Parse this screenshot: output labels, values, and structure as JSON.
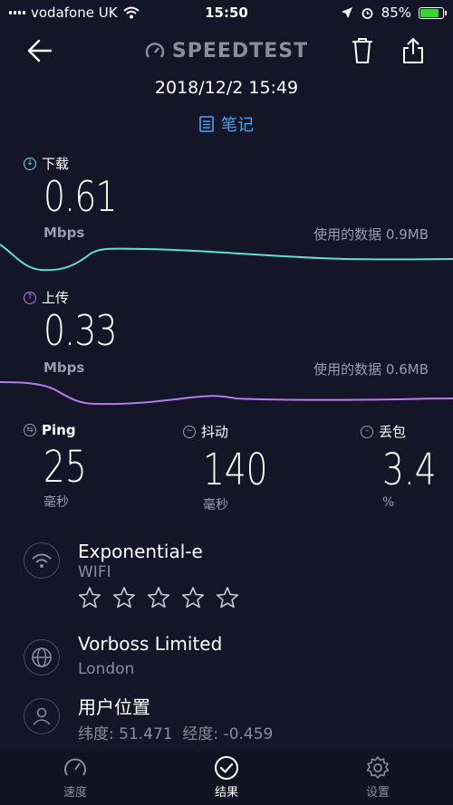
{
  "status_bar": {
    "carrier": "vodafone UK",
    "time": "15:50",
    "battery": "85%",
    "battery_level": 0.85
  },
  "header": {
    "brand": "SPEEDTEST",
    "datetime": "2018/12/2 15:49",
    "notes_label": "笔记"
  },
  "download": {
    "label": "下载",
    "value": "0.61",
    "unit": "Mbps",
    "data_used": "使用的数据 0.9MB",
    "color": "#5ce1d6"
  },
  "upload": {
    "label": "上传",
    "value": "0.33",
    "unit": "Mbps",
    "data_used": "使用的数据 0.6MB",
    "color": "#b57cf2"
  },
  "metrics": [
    {
      "label": "Ping",
      "value": "25",
      "unit": "毫秒"
    },
    {
      "label": "抖动",
      "value": "140",
      "unit": "毫秒"
    },
    {
      "label": "丢包",
      "value": "3.4",
      "unit": "%"
    }
  ],
  "connection": {
    "name": "Exponential-e",
    "type": "WIFI",
    "rating_max": 5
  },
  "provider": {
    "name": "Vorboss Limited",
    "city": "London"
  },
  "location": {
    "title": "用户位置",
    "coords": "纬度: 51.471  经度: -0.459"
  },
  "tabs": [
    {
      "label": "速度",
      "icon": "speedometer-icon"
    },
    {
      "label": "结果",
      "icon": "check-circle-icon"
    },
    {
      "label": "设置",
      "icon": "gear-icon"
    }
  ]
}
